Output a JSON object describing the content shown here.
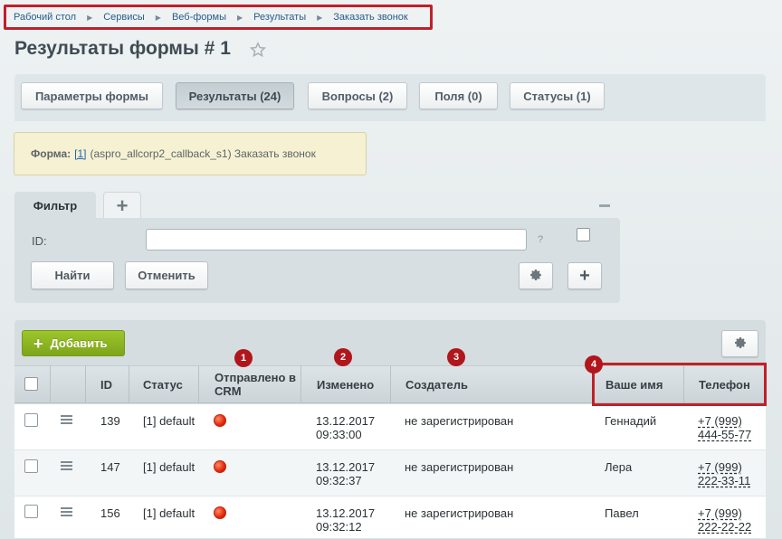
{
  "breadcrumb": [
    "Рабочий стол",
    "Сервисы",
    "Веб-формы",
    "Результаты",
    "Заказать звонок"
  ],
  "page": {
    "title": "Результаты формы # 1"
  },
  "tabs": [
    {
      "label": "Параметры формы"
    },
    {
      "label": "Результаты (24)"
    },
    {
      "label": "Вопросы (2)"
    },
    {
      "label": "Поля (0)"
    },
    {
      "label": "Статусы (1)"
    }
  ],
  "form_info": {
    "label": "Форма:",
    "link": "[1]",
    "text": "(aspro_allcorp2_callback_s1) Заказать звонок"
  },
  "filter": {
    "tab_label": "Фильтр",
    "add_tab": "+",
    "id_label": "ID:",
    "id_value": "",
    "help": "?",
    "find_button": "Найти",
    "cancel_button": "Отменить",
    "add_button": "+"
  },
  "toolbar": {
    "add_button": "Добавить"
  },
  "table": {
    "columns": [
      "ID",
      "Статус",
      "Отправлено в CRM",
      "Изменено",
      "Создатель",
      "Ваше имя",
      "Телефон"
    ],
    "rows": [
      {
        "id": "139",
        "status": "[1] default",
        "changed_date": "13.12.2017",
        "changed_time": "09:33:00",
        "creator": "не зарегистрирован",
        "name": "Геннадий",
        "phone1": "+7 (999)",
        "phone2": "444-55-77"
      },
      {
        "id": "147",
        "status": "[1] default",
        "changed_date": "13.12.2017",
        "changed_time": "09:32:37",
        "creator": "не зарегистрирован",
        "name": "Лера",
        "phone1": "+7 (999)",
        "phone2": "222-33-11"
      },
      {
        "id": "156",
        "status": "[1] default",
        "changed_date": "13.12.2017",
        "changed_time": "09:32:12",
        "creator": "не зарегистрирован",
        "name": "Павел",
        "phone1": "+7 (999)",
        "phone2": "222-22-22"
      }
    ]
  },
  "markers": [
    "1",
    "2",
    "3",
    "4"
  ],
  "colors": {
    "accent": "#c0202a",
    "add_button": "#8ab522",
    "crm_status": "#e3280d",
    "link": "#2067b0"
  }
}
